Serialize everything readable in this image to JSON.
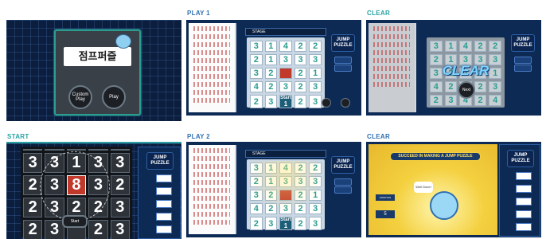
{
  "labels": {
    "play1": "PLAY 1",
    "clear1": "CLEAR",
    "start": "START",
    "play2": "PLAY 2",
    "clear2": "CLEAR"
  },
  "title_panel": {
    "game_title": "점프퍼즐",
    "buttons": [
      "Custom Play",
      "Play"
    ]
  },
  "game": {
    "stage_label": "STAGE",
    "logo_line1": "JUMP",
    "logo_line2": "PUZZLE",
    "board_play1": [
      [
        3,
        1,
        4,
        2,
        2
      ],
      [
        2,
        1,
        3,
        2,
        3
      ],
      [
        3,
        2,
        "cur",
        2,
        1
      ],
      [
        4,
        2,
        3,
        2,
        3
      ],
      [
        2,
        3,
        "cur2",
        2,
        4
      ]
    ],
    "current_tile_label": "Start",
    "current_tile_value": "1",
    "clear_text": "CLEAR",
    "clear_button": "Next",
    "start_number": "8",
    "start_button": "Start",
    "success_banner": "SUCCEED IN MAKING A JUMP PUZZLE",
    "success_bubble": "Well Done!",
    "success_info_label": "POSITION",
    "success_info_value": "5"
  },
  "colors": {
    "accent_teal": "#2a9d8f",
    "panel_navy": "#0d2a55",
    "label_blue": "#2f6fb1",
    "label_teal": "#27a3a3",
    "highlight_red": "#c0392b",
    "banner_yellow": "#f4d03f"
  }
}
